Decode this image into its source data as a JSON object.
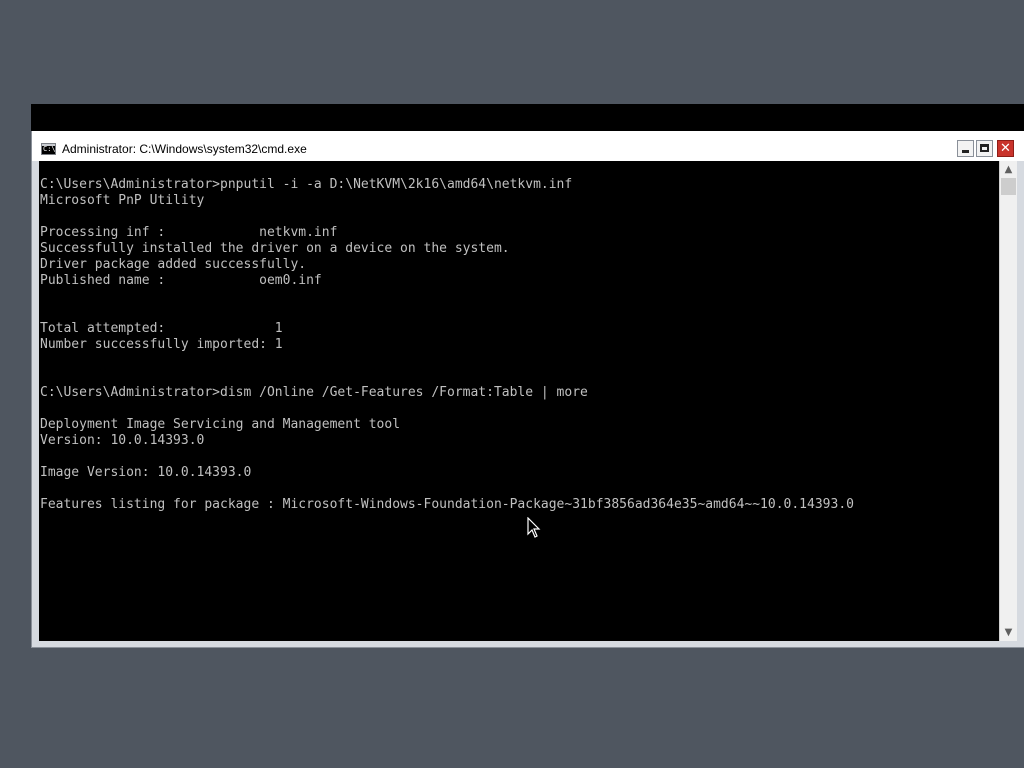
{
  "window": {
    "title": "Administrator: C:\\Windows\\system32\\cmd.exe",
    "icon_text": "C:\\",
    "close_glyph": "✕"
  },
  "console": {
    "lines": [
      "C:\\Users\\Administrator>pnputil -i -a D:\\NetKVM\\2k16\\amd64\\netkvm.inf",
      "Microsoft PnP Utility",
      "",
      "Processing inf :            netkvm.inf",
      "Successfully installed the driver on a device on the system.",
      "Driver package added successfully.",
      "Published name :            oem0.inf",
      "",
      "",
      "Total attempted:              1",
      "Number successfully imported: 1",
      "",
      "",
      "C:\\Users\\Administrator>dism /Online /Get-Features /Format:Table | more",
      "",
      "Deployment Image Servicing and Management tool",
      "Version: 10.0.14393.0",
      "",
      "Image Version: 10.0.14393.0",
      "",
      "Features listing for package : Microsoft-Windows-Foundation-Package~31bf3856ad364e35~amd64~~10.0.14393.0"
    ],
    "text_color": "#c0c0c0",
    "background": "#000000"
  },
  "scrollbar": {
    "up_glyph": "▲",
    "down_glyph": "▼"
  },
  "desktop": {
    "background": "#4f5660"
  }
}
